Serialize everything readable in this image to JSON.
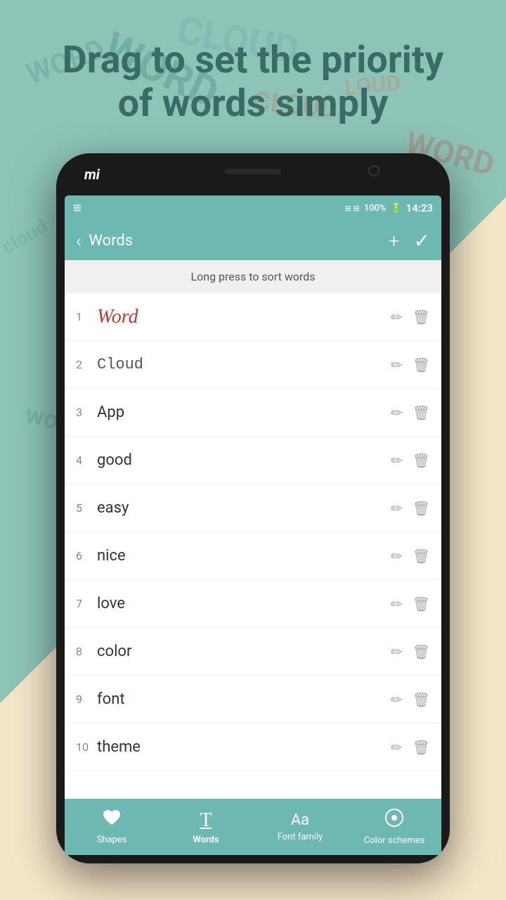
{
  "headline": {
    "line1": "Drag to set the priority",
    "line2": "of words simply"
  },
  "status_bar": {
    "icons": "⊞ ⊞",
    "battery": "100%",
    "time": "14:23"
  },
  "top_bar": {
    "back_label": "‹",
    "title": "Words",
    "add_label": "+",
    "confirm_label": "✓"
  },
  "hint": {
    "text": "Long press to sort words"
  },
  "words": [
    {
      "num": 1,
      "text": "Word",
      "style": "handwritten"
    },
    {
      "num": 2,
      "text": "Cloud",
      "style": "typed"
    },
    {
      "num": 3,
      "text": "App",
      "style": "normal"
    },
    {
      "num": 4,
      "text": "good",
      "style": "normal"
    },
    {
      "num": 5,
      "text": "easy",
      "style": "normal"
    },
    {
      "num": 6,
      "text": "nice",
      "style": "normal"
    },
    {
      "num": 7,
      "text": "love",
      "style": "normal"
    },
    {
      "num": 8,
      "text": "color",
      "style": "normal"
    },
    {
      "num": 9,
      "text": "font",
      "style": "normal"
    },
    {
      "num": 10,
      "text": "theme",
      "style": "normal"
    }
  ],
  "bottom_nav": {
    "items": [
      {
        "id": "shapes",
        "label": "Shapes",
        "icon": "♥"
      },
      {
        "id": "words",
        "label": "Words",
        "icon": "T̲"
      },
      {
        "id": "font_family",
        "label": "Font family",
        "icon": "Aa"
      },
      {
        "id": "color_schemes",
        "label": "Color schemes",
        "icon": "◉"
      }
    ]
  },
  "phone": {
    "logo": "mi"
  }
}
